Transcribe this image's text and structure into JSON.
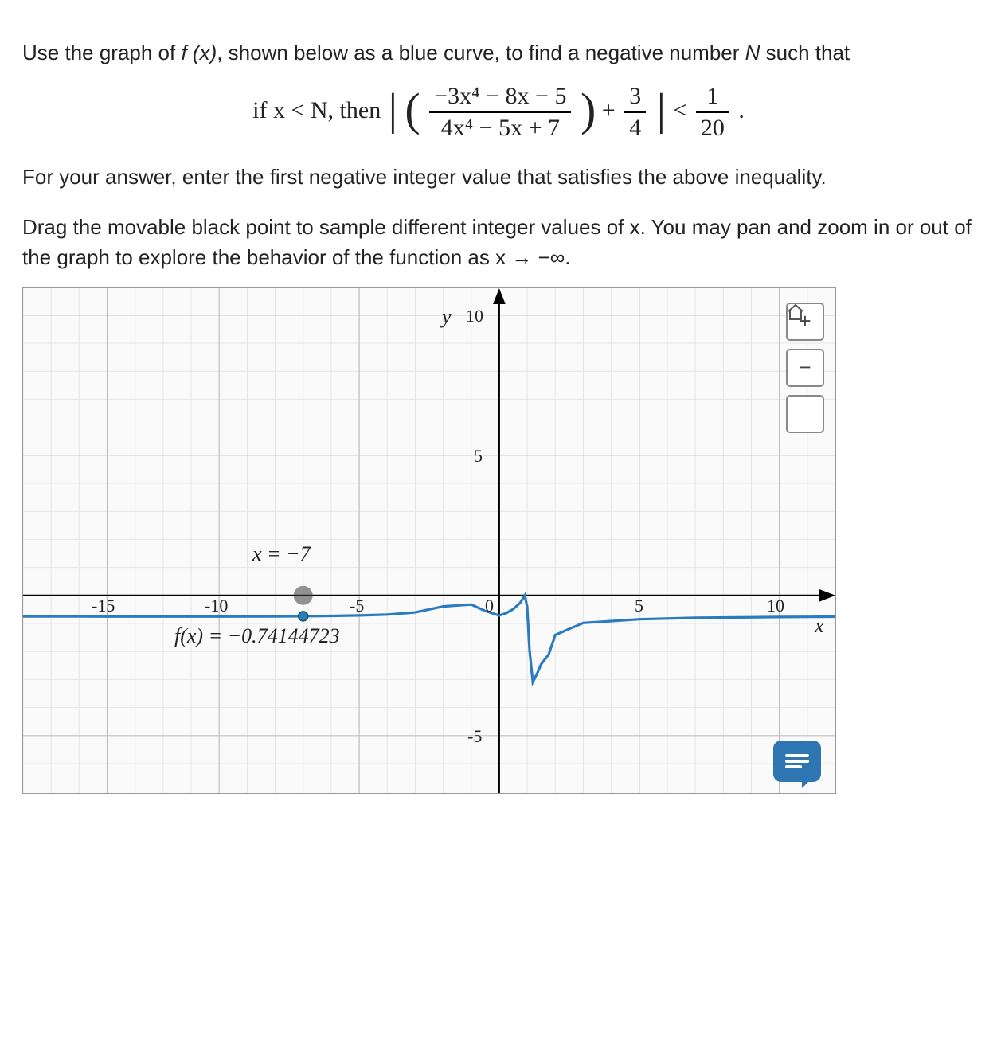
{
  "intro_prefix": "Use the graph of ",
  "intro_fx": "f (x)",
  "intro_suffix": ", shown below as a blue curve, to find a negative number ",
  "intro_nvar": "N",
  "intro_tail": " such that",
  "cond_prefix": "if x < N, then ",
  "frac_inner_num": "−3x⁴ − 8x − 5",
  "frac_inner_den": "4x⁴ − 5x + 7",
  "plus": " + ",
  "three": "3",
  "four": "4",
  "lt": " < ",
  "one": "1",
  "twenty": "20",
  "dot": " .",
  "para2": "For your answer, enter the first negative integer value that satisfies the above inequality.",
  "para3": "Drag the movable black point to sample different integer values of x. You may pan and zoom in or out of the graph to explore the behavior of the function as x → −∞.",
  "graph": {
    "y_label": "y",
    "x_label": "x",
    "ticks_x": [
      "-15",
      "-10",
      "-5",
      "0",
      "5",
      "10"
    ],
    "ticks_y": [
      "10",
      "5",
      "-5"
    ],
    "point_label": "x = −7",
    "fx_label": "f(x) = −0.74144723"
  },
  "controls": {
    "zoom_in": "+",
    "zoom_out": "−"
  },
  "chart_data": {
    "type": "line",
    "title": "",
    "xlabel": "x",
    "ylabel": "y",
    "xlim": [
      -17,
      12
    ],
    "ylim": [
      -7,
      11
    ],
    "series": [
      {
        "name": "f(x)",
        "x": [
          -17,
          -15,
          -12,
          -10,
          -8,
          -7,
          -6,
          -5,
          -4,
          -3,
          -2,
          -1,
          -0.5,
          0,
          0.5,
          1,
          1.2,
          1.5,
          2,
          3,
          5,
          7,
          10,
          12
        ],
        "y": [
          -0.751,
          -0.751,
          -0.752,
          -0.753,
          -0.748,
          -0.741,
          -0.731,
          -0.714,
          -0.681,
          -0.604,
          -0.392,
          -0.324,
          -0.554,
          -0.71,
          -0.49,
          0,
          -3.09,
          -2.45,
          -1.41,
          -0.98,
          -0.85,
          -0.8,
          -0.77,
          -0.76
        ]
      }
    ],
    "annotations": [
      {
        "text": "x = −7",
        "x": -7,
        "y": 1.2
      },
      {
        "text": "f(x) = −0.74144723",
        "x": -7,
        "y": -1.4
      }
    ],
    "movable_point": {
      "x": -7,
      "y": -0.741
    }
  }
}
